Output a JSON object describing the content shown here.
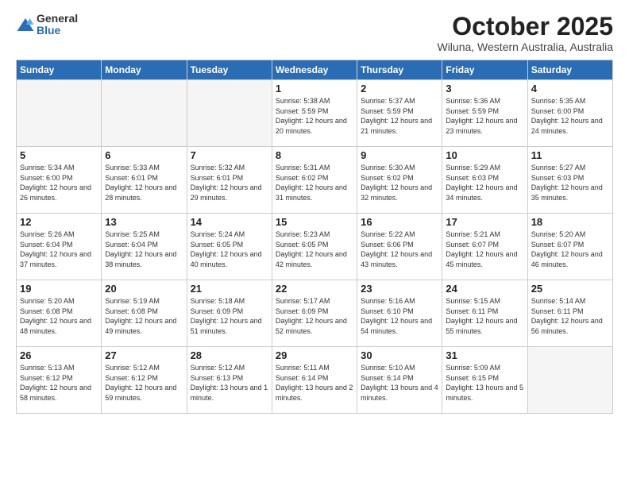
{
  "logo": {
    "general": "General",
    "blue": "Blue"
  },
  "title": "October 2025",
  "subtitle": "Wiluna, Western Australia, Australia",
  "days_of_week": [
    "Sunday",
    "Monday",
    "Tuesday",
    "Wednesday",
    "Thursday",
    "Friday",
    "Saturday"
  ],
  "weeks": [
    [
      {
        "day": "",
        "info": ""
      },
      {
        "day": "",
        "info": ""
      },
      {
        "day": "",
        "info": ""
      },
      {
        "day": "1",
        "info": "Sunrise: 5:38 AM\nSunset: 5:59 PM\nDaylight: 12 hours\nand 20 minutes."
      },
      {
        "day": "2",
        "info": "Sunrise: 5:37 AM\nSunset: 5:59 PM\nDaylight: 12 hours\nand 21 minutes."
      },
      {
        "day": "3",
        "info": "Sunrise: 5:36 AM\nSunset: 5:59 PM\nDaylight: 12 hours\nand 23 minutes."
      },
      {
        "day": "4",
        "info": "Sunrise: 5:35 AM\nSunset: 6:00 PM\nDaylight: 12 hours\nand 24 minutes."
      }
    ],
    [
      {
        "day": "5",
        "info": "Sunrise: 5:34 AM\nSunset: 6:00 PM\nDaylight: 12 hours\nand 26 minutes."
      },
      {
        "day": "6",
        "info": "Sunrise: 5:33 AM\nSunset: 6:01 PM\nDaylight: 12 hours\nand 28 minutes."
      },
      {
        "day": "7",
        "info": "Sunrise: 5:32 AM\nSunset: 6:01 PM\nDaylight: 12 hours\nand 29 minutes."
      },
      {
        "day": "8",
        "info": "Sunrise: 5:31 AM\nSunset: 6:02 PM\nDaylight: 12 hours\nand 31 minutes."
      },
      {
        "day": "9",
        "info": "Sunrise: 5:30 AM\nSunset: 6:02 PM\nDaylight: 12 hours\nand 32 minutes."
      },
      {
        "day": "10",
        "info": "Sunrise: 5:29 AM\nSunset: 6:03 PM\nDaylight: 12 hours\nand 34 minutes."
      },
      {
        "day": "11",
        "info": "Sunrise: 5:27 AM\nSunset: 6:03 PM\nDaylight: 12 hours\nand 35 minutes."
      }
    ],
    [
      {
        "day": "12",
        "info": "Sunrise: 5:26 AM\nSunset: 6:04 PM\nDaylight: 12 hours\nand 37 minutes."
      },
      {
        "day": "13",
        "info": "Sunrise: 5:25 AM\nSunset: 6:04 PM\nDaylight: 12 hours\nand 38 minutes."
      },
      {
        "day": "14",
        "info": "Sunrise: 5:24 AM\nSunset: 6:05 PM\nDaylight: 12 hours\nand 40 minutes."
      },
      {
        "day": "15",
        "info": "Sunrise: 5:23 AM\nSunset: 6:05 PM\nDaylight: 12 hours\nand 42 minutes."
      },
      {
        "day": "16",
        "info": "Sunrise: 5:22 AM\nSunset: 6:06 PM\nDaylight: 12 hours\nand 43 minutes."
      },
      {
        "day": "17",
        "info": "Sunrise: 5:21 AM\nSunset: 6:07 PM\nDaylight: 12 hours\nand 45 minutes."
      },
      {
        "day": "18",
        "info": "Sunrise: 5:20 AM\nSunset: 6:07 PM\nDaylight: 12 hours\nand 46 minutes."
      }
    ],
    [
      {
        "day": "19",
        "info": "Sunrise: 5:20 AM\nSunset: 6:08 PM\nDaylight: 12 hours\nand 48 minutes."
      },
      {
        "day": "20",
        "info": "Sunrise: 5:19 AM\nSunset: 6:08 PM\nDaylight: 12 hours\nand 49 minutes."
      },
      {
        "day": "21",
        "info": "Sunrise: 5:18 AM\nSunset: 6:09 PM\nDaylight: 12 hours\nand 51 minutes."
      },
      {
        "day": "22",
        "info": "Sunrise: 5:17 AM\nSunset: 6:09 PM\nDaylight: 12 hours\nand 52 minutes."
      },
      {
        "day": "23",
        "info": "Sunrise: 5:16 AM\nSunset: 6:10 PM\nDaylight: 12 hours\nand 54 minutes."
      },
      {
        "day": "24",
        "info": "Sunrise: 5:15 AM\nSunset: 6:11 PM\nDaylight: 12 hours\nand 55 minutes."
      },
      {
        "day": "25",
        "info": "Sunrise: 5:14 AM\nSunset: 6:11 PM\nDaylight: 12 hours\nand 56 minutes."
      }
    ],
    [
      {
        "day": "26",
        "info": "Sunrise: 5:13 AM\nSunset: 6:12 PM\nDaylight: 12 hours\nand 58 minutes."
      },
      {
        "day": "27",
        "info": "Sunrise: 5:12 AM\nSunset: 6:12 PM\nDaylight: 12 hours\nand 59 minutes."
      },
      {
        "day": "28",
        "info": "Sunrise: 5:12 AM\nSunset: 6:13 PM\nDaylight: 13 hours\nand 1 minute."
      },
      {
        "day": "29",
        "info": "Sunrise: 5:11 AM\nSunset: 6:14 PM\nDaylight: 13 hours\nand 2 minutes."
      },
      {
        "day": "30",
        "info": "Sunrise: 5:10 AM\nSunset: 6:14 PM\nDaylight: 13 hours\nand 4 minutes."
      },
      {
        "day": "31",
        "info": "Sunrise: 5:09 AM\nSunset: 6:15 PM\nDaylight: 13 hours\nand 5 minutes."
      },
      {
        "day": "",
        "info": ""
      }
    ]
  ]
}
